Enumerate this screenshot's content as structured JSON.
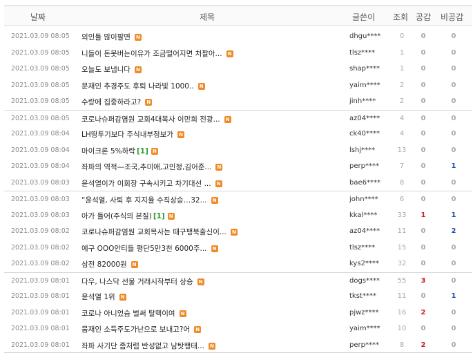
{
  "header": {
    "date": "날짜",
    "title": "제목",
    "author": "글쓴이",
    "views": "조회",
    "like": "공감",
    "dislike": "비공감"
  },
  "badge": {
    "new": "N"
  },
  "colors": {
    "badge": "#f08a24",
    "like_positive": "#cc1f1f",
    "dislike_positive": "#1f4fa8",
    "comment_count": "#2e9b2e"
  },
  "posts": [
    {
      "date": "2021.03.09 08:05",
      "title": "외인들 많이팔면",
      "comments": "",
      "author": "dhgu****",
      "views": "0",
      "like": "0",
      "dislike": "0"
    },
    {
      "date": "2021.03.09 08:05",
      "title": "니들이 돈못버는이유가 조금떨어지면 처팔아...",
      "comments": "",
      "author": "tlsz****",
      "views": "1",
      "like": "0",
      "dislike": "0"
    },
    {
      "date": "2021.03.09 08:05",
      "title": "오늘도 보냅니다",
      "comments": "",
      "author": "shap****",
      "views": "1",
      "like": "0",
      "dislike": "0"
    },
    {
      "date": "2021.03.09 08:05",
      "title": "문재인 추경주도 후퇴 나라빛 1000..",
      "comments": "",
      "author": "yaim****",
      "views": "2",
      "like": "0",
      "dislike": "0"
    },
    {
      "date": "2021.03.09 08:05",
      "title": "수랑에 집중하라고?",
      "comments": "",
      "author": "jinh****",
      "views": "2",
      "like": "0",
      "dislike": "0"
    },
    {
      "date": "2021.03.09 08:05",
      "title": "코로나슈퍼감염원 교회4대목사 이만희 전광...",
      "comments": "",
      "author": "az04****",
      "views": "4",
      "like": "0",
      "dislike": "0"
    },
    {
      "date": "2021.03.09 08:04",
      "title": "LH땅투기보다 주식내부정보가",
      "comments": "",
      "author": "ck40****",
      "views": "4",
      "like": "0",
      "dislike": "0"
    },
    {
      "date": "2021.03.09 08:04",
      "title": "마이크론 5%하락",
      "comments": "[1]",
      "author": "lshj****",
      "views": "13",
      "like": "0",
      "dislike": "0"
    },
    {
      "date": "2021.03.09 08:04",
      "title": "좌파의 역적—조국,추미애,고민정,김어준...",
      "comments": "",
      "author": "perp****",
      "views": "7",
      "like": "0",
      "dislike": "1"
    },
    {
      "date": "2021.03.09 08:03",
      "title": "윤석열이가 이회장 구속시키고 차기대선 ...",
      "comments": "",
      "author": "bae6****",
      "views": "8",
      "like": "0",
      "dislike": "0"
    },
    {
      "date": "2021.03.09 08:03",
      "title": "“윤석열, 사퇴 후 지지율 수직상승…32...",
      "comments": "",
      "author": "john****",
      "views": "6",
      "like": "0",
      "dislike": "0"
    },
    {
      "date": "2021.03.09 08:03",
      "title": "아가 들어(주식의 본질)",
      "comments": "[1]",
      "author": "kkal****",
      "views": "33",
      "like": "1",
      "dislike": "1"
    },
    {
      "date": "2021.03.09 08:02",
      "title": "코로나슈퍼감염원 교회목사는 때구팽북출신이...",
      "comments": "",
      "author": "az04****",
      "views": "11",
      "like": "0",
      "dislike": "2"
    },
    {
      "date": "2021.03.09 08:02",
      "title": "예구 OOO안티들 평단5만3천 6000주...",
      "comments": "",
      "author": "tlsz****",
      "views": "15",
      "like": "0",
      "dislike": "0"
    },
    {
      "date": "2021.03.09 08:02",
      "title": "삼전 82000원",
      "comments": "",
      "author": "kys2****",
      "views": "32",
      "like": "0",
      "dislike": "0"
    },
    {
      "date": "2021.03.09 08:01",
      "title": "다우, 나스닥 선물 거래시작부터 상승",
      "comments": "",
      "author": "dogs****",
      "views": "55",
      "like": "3",
      "dislike": "0"
    },
    {
      "date": "2021.03.09 08:01",
      "title": "윤석열 1위",
      "comments": "",
      "author": "tkst****",
      "views": "11",
      "like": "0",
      "dislike": "1"
    },
    {
      "date": "2021.03.09 08:01",
      "title": "코로나 아니었슴 벌써 탈핵이여",
      "comments": "",
      "author": "pjwz****",
      "views": "16",
      "like": "2",
      "dislike": "0"
    },
    {
      "date": "2021.03.09 08:01",
      "title": "뭄재인 소득주도가난으로 보내고?어",
      "comments": "",
      "author": "yaim****",
      "views": "10",
      "like": "0",
      "dislike": "0"
    },
    {
      "date": "2021.03.09 08:01",
      "title": "좌파 사기단 좀처럼 반성없고 남탓행태...",
      "comments": "",
      "author": "perp****",
      "views": "8",
      "like": "2",
      "dislike": "0"
    }
  ]
}
